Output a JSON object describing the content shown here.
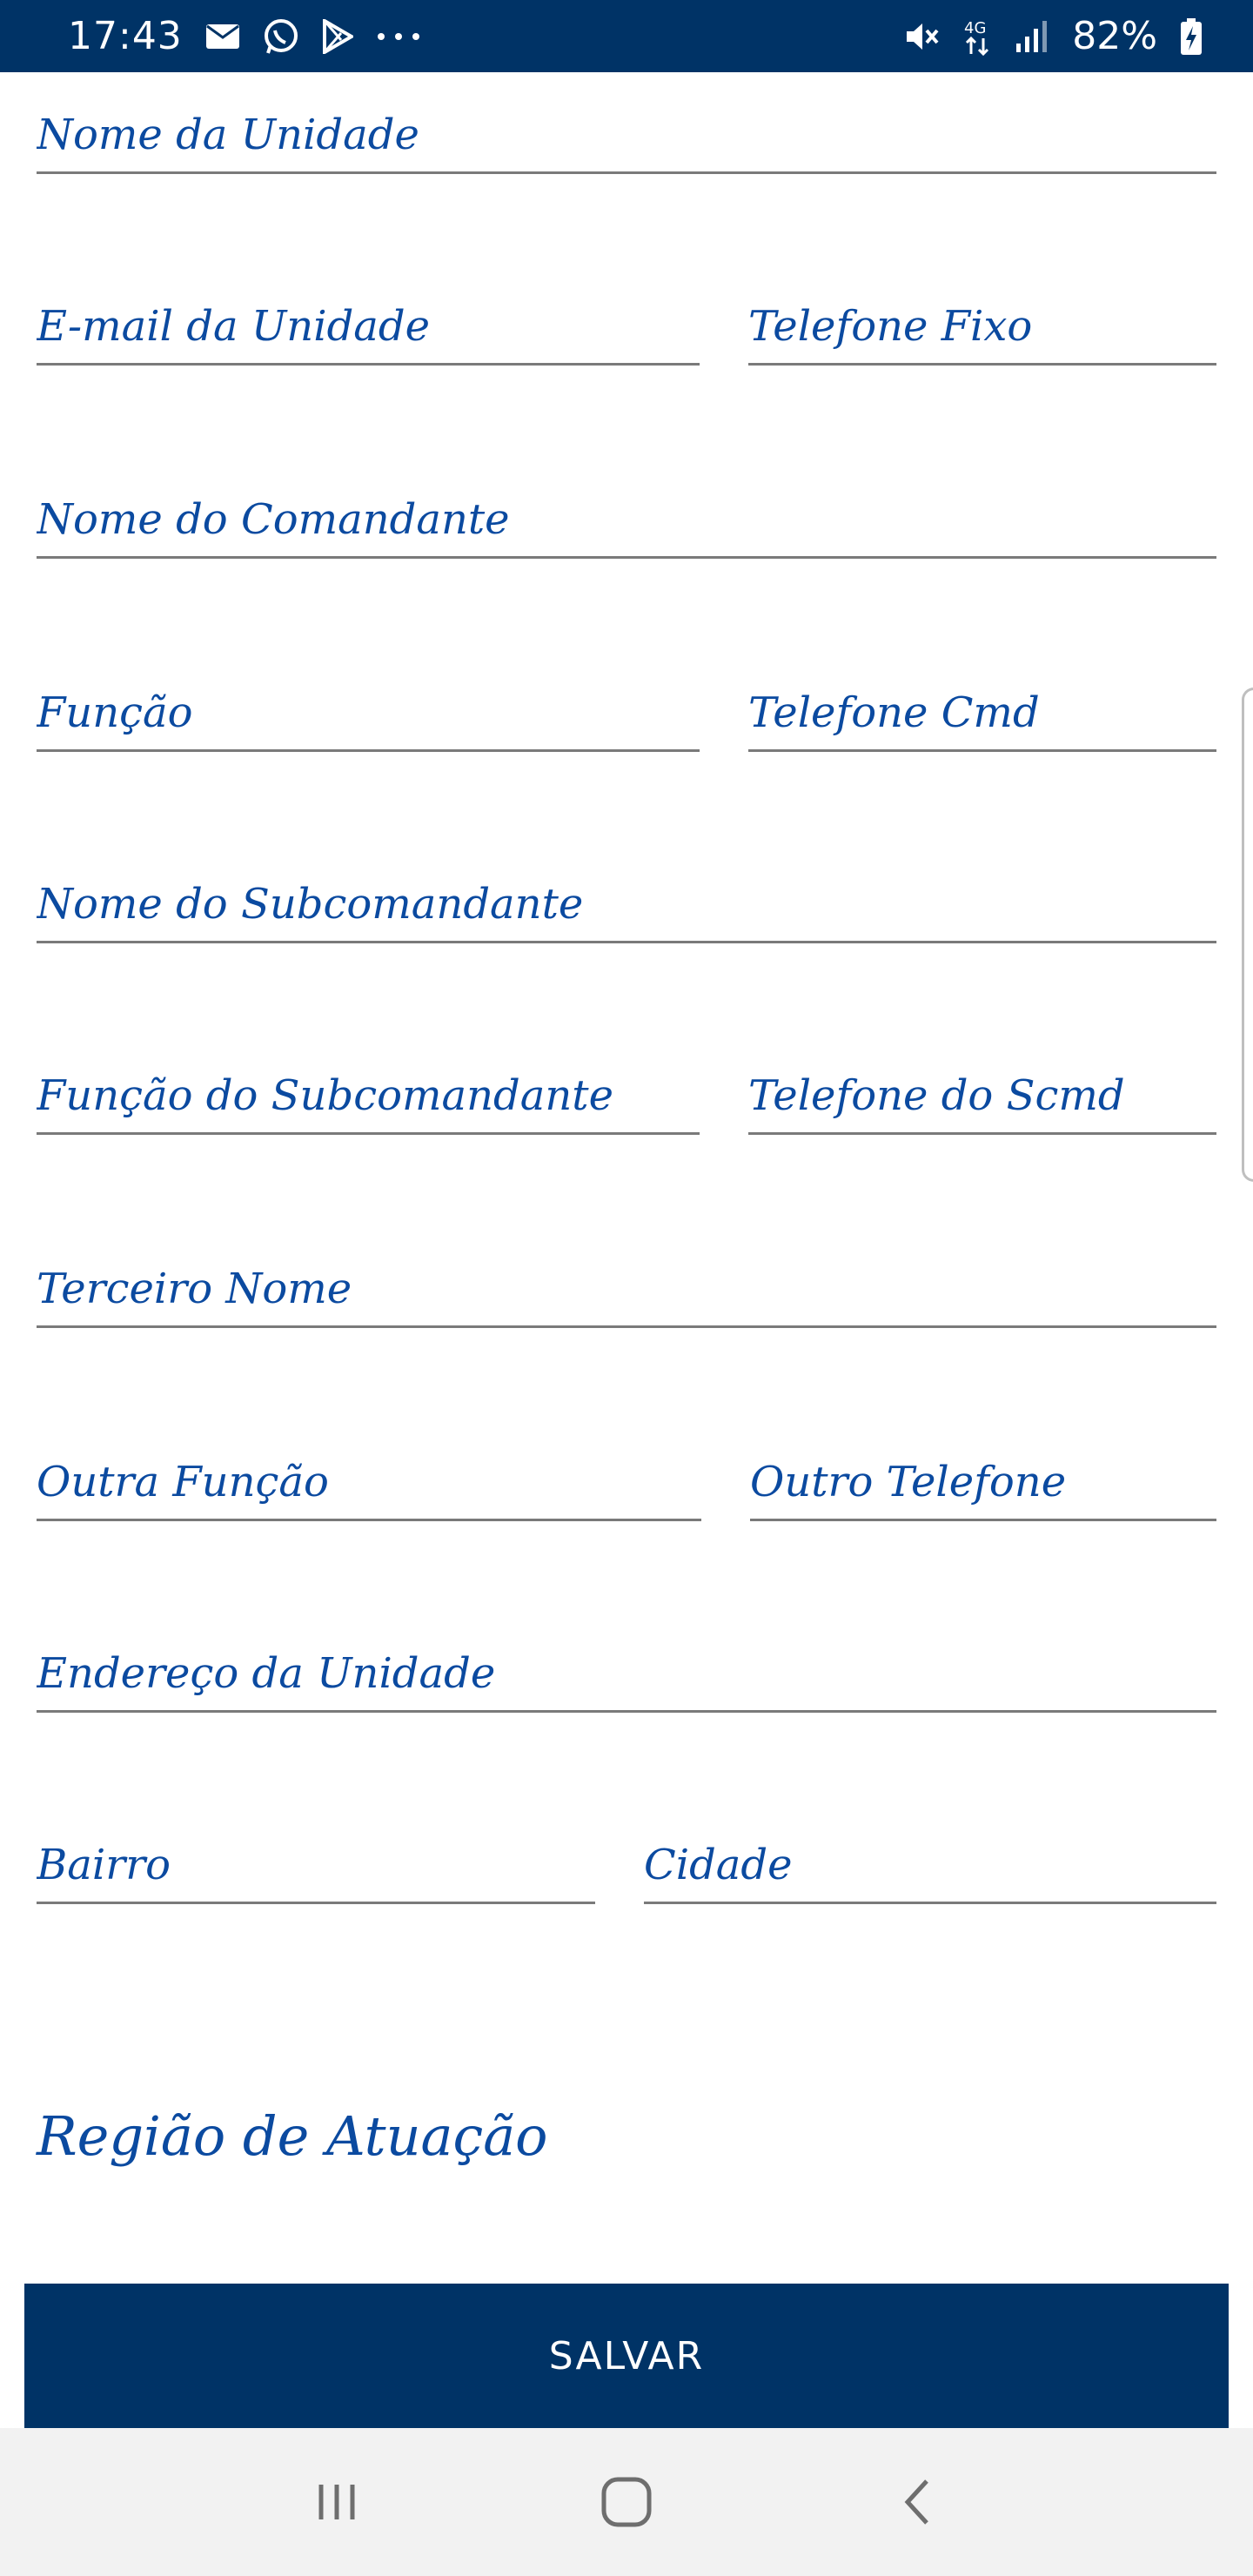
{
  "status_bar": {
    "time": "17:43",
    "battery": "82%",
    "left_icons": [
      "email-icon",
      "whatsapp-icon",
      "play-store-icon",
      "more-dots-icon"
    ],
    "right_icons": [
      "mute-icon",
      "4g-icon",
      "signal-icon",
      "battery-charging-icon"
    ],
    "network_label": "4G"
  },
  "form": {
    "nome_unidade": {
      "placeholder": "Nome da Unidade",
      "value": ""
    },
    "email_unidade": {
      "placeholder": "E-mail da Unidade",
      "value": ""
    },
    "telefone_fixo": {
      "placeholder": "Telefone Fixo",
      "value": ""
    },
    "nome_comandante": {
      "placeholder": "Nome do Comandante",
      "value": ""
    },
    "funcao": {
      "placeholder": "Função",
      "value": ""
    },
    "telefone_cmd": {
      "placeholder": "Telefone Cmd",
      "value": ""
    },
    "nome_subcomandante": {
      "placeholder": "Nome do Subcomandante",
      "value": ""
    },
    "funcao_subcomandante": {
      "placeholder": "Função do Subcomandante",
      "value": ""
    },
    "telefone_scmd": {
      "placeholder": "Telefone do Scmd",
      "value": ""
    },
    "terceiro_nome": {
      "placeholder": "Terceiro Nome",
      "value": ""
    },
    "outra_funcao": {
      "placeholder": "Outra Função",
      "value": ""
    },
    "outro_telefone": {
      "placeholder": "Outro Telefone",
      "value": ""
    },
    "endereco_unidade": {
      "placeholder": "Endereço da Unidade",
      "value": ""
    },
    "bairro": {
      "placeholder": "Bairro",
      "value": ""
    },
    "cidade": {
      "placeholder": "Cidade",
      "value": ""
    }
  },
  "section": {
    "regiao_title": "Região de Atuação"
  },
  "actions": {
    "save_label": "SALVAR"
  },
  "nav_bar": {
    "icons": [
      "recent-apps-icon",
      "home-icon",
      "back-icon"
    ]
  },
  "colors": {
    "primary": "#003366",
    "label": "#0b4aa0",
    "nav_bg": "#f2f2f2"
  }
}
